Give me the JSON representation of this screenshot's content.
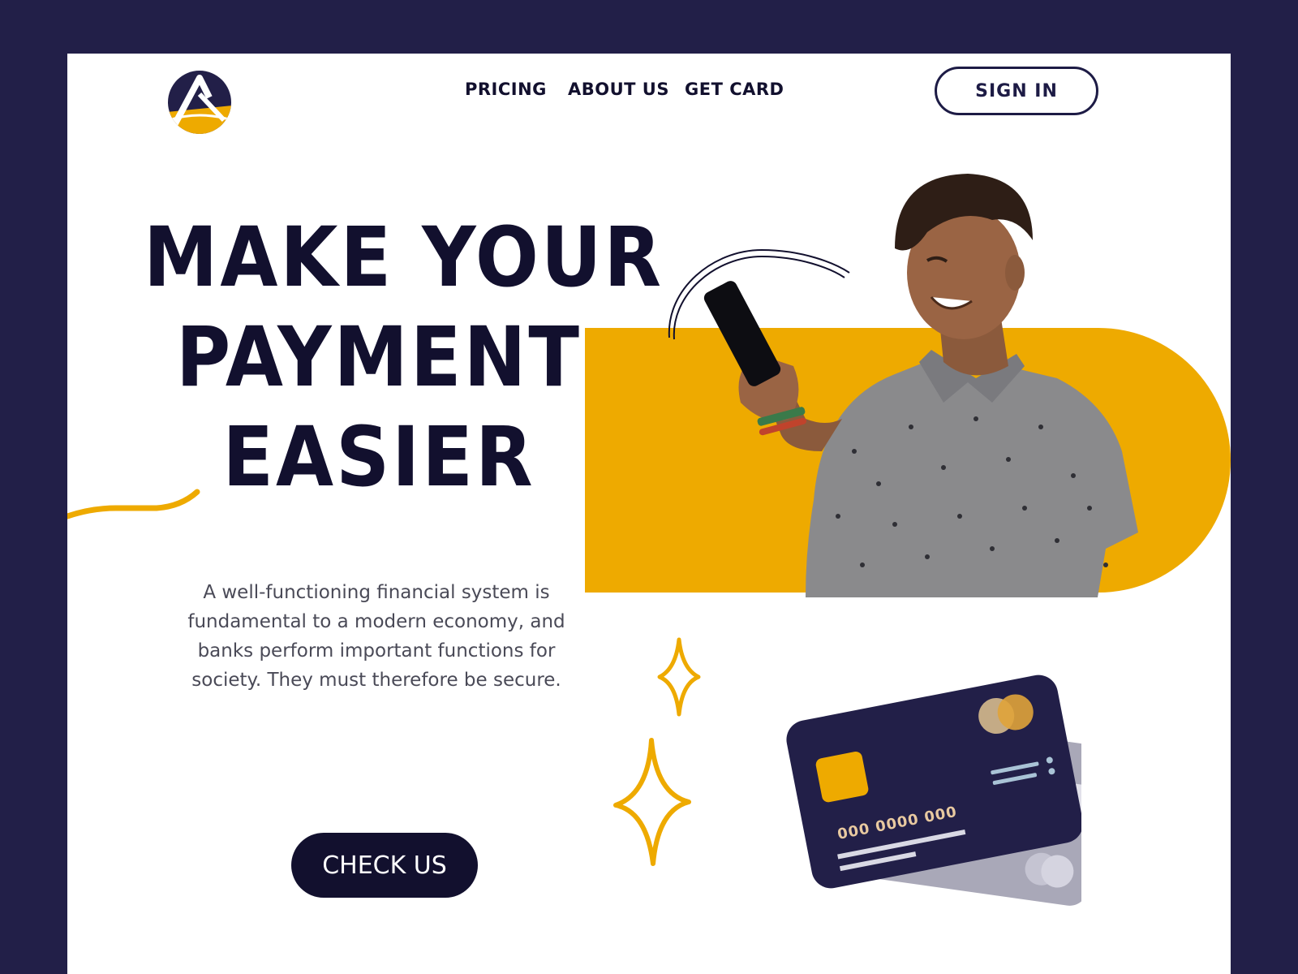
{
  "nav": {
    "links": [
      "PRICING",
      "ABOUT US",
      "GET CARD"
    ],
    "signin_label": "SIGN IN"
  },
  "hero": {
    "headline_lines": [
      "MAKE YOUR",
      "PAYMENT",
      "EASIER"
    ],
    "description": "A well-functioning financial system is fundamental to a modern economy, and banks perform important functions for society. They must therefore be secure.",
    "cta_label": "CHECK US"
  },
  "card": {
    "number": "000 0000 000"
  },
  "colors": {
    "navy": "#221f48",
    "ink": "#12102e",
    "accent": "#eeaa00",
    "white": "#ffffff"
  },
  "icons": {
    "logo": "triangle-logo-icon",
    "sparkles": "sparkle-icon"
  }
}
